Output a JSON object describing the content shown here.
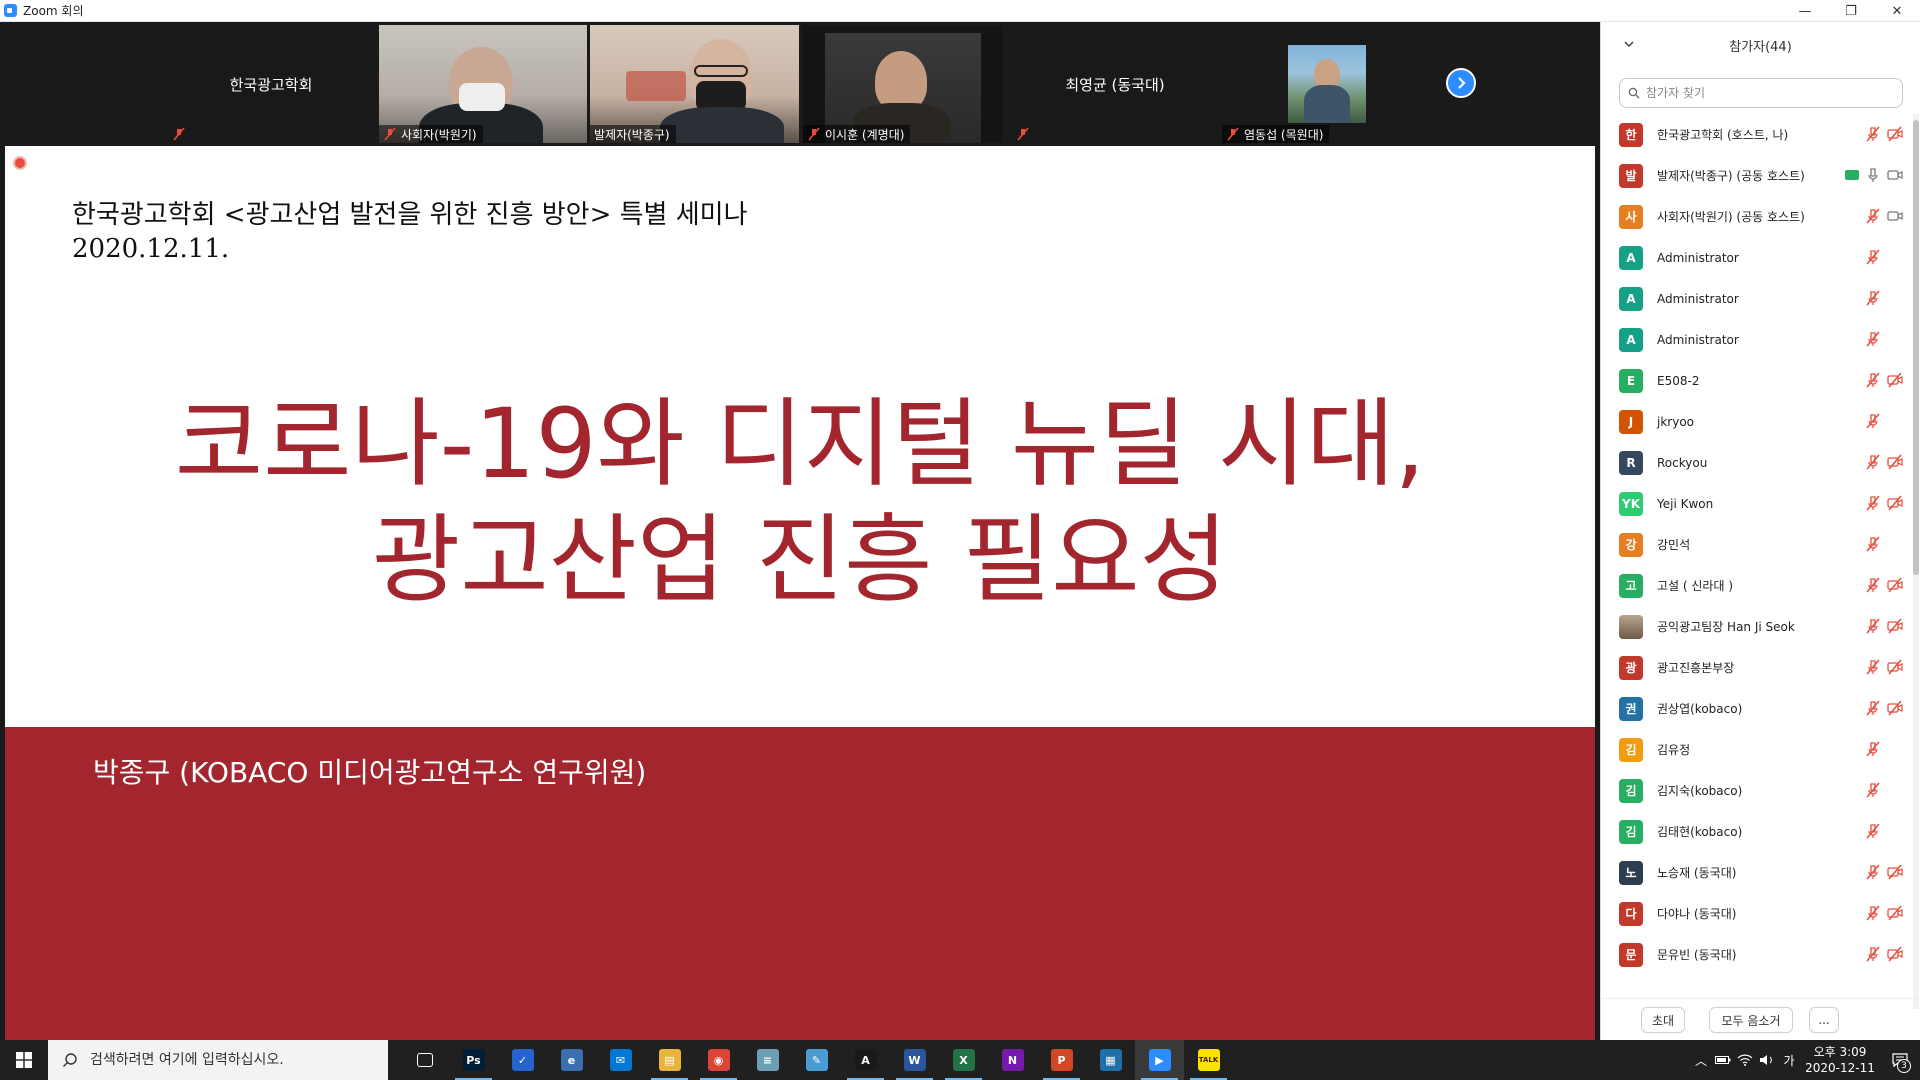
{
  "window": {
    "title": "Zoom 회의",
    "controls": [
      "—",
      "❐",
      "✕"
    ]
  },
  "thumbnails": [
    {
      "type": "name",
      "name": "한국광고학회",
      "label": "",
      "muted": true
    },
    {
      "type": "video",
      "name": "사회자(박원기)",
      "label": "사회자(박원기)",
      "muted": true
    },
    {
      "type": "video",
      "name": "발제자(박종구)",
      "label": "발제자(박종구)",
      "muted": false,
      "active": true
    },
    {
      "type": "video",
      "name": "이시훈 (계명대)",
      "label": "이시훈 (계명대)",
      "muted": true
    },
    {
      "type": "name",
      "name": "최영균 (동국대)",
      "label": "",
      "muted": true
    },
    {
      "type": "video",
      "name": "염동섭 (목원대)",
      "label": "염동섭 (목원대)",
      "muted": true
    }
  ],
  "slide": {
    "header_line1": "한국광고학회 <광고산업 발전을 위한 진흥 방안> 특별 세미나",
    "header_line2": "2020.12.11.",
    "title_line1": "코로나-19와 디지털 뉴딜 시대,",
    "title_line2": "광고산업 진흥 필요성",
    "presenter": "박종구 (KOBACO 미디어광고연구소 연구위원)",
    "accent_color": "#a3262f"
  },
  "panel": {
    "title": "참가자(44)",
    "search_placeholder": "참가자 찾기",
    "participants": [
      {
        "initial": "한",
        "color": "#c0392b",
        "name": "한국광고학회 (호스트, 나)",
        "mic": "muted",
        "video": "off"
      },
      {
        "initial": "발",
        "color": "#c0392b",
        "name": "발제자(박종구) (공동 호스트)",
        "mic": "on",
        "video": "on",
        "sharing": true
      },
      {
        "initial": "사",
        "color": "#e67e22",
        "name": "사회자(박원기) (공동 호스트)",
        "mic": "muted",
        "video": "on"
      },
      {
        "initial": "A",
        "color": "#16a085",
        "name": "Administrator",
        "mic": "muted",
        "video": "none"
      },
      {
        "initial": "A",
        "color": "#16a085",
        "name": "Administrator",
        "mic": "muted",
        "video": "none"
      },
      {
        "initial": "A",
        "color": "#16a085",
        "name": "Administrator",
        "mic": "muted",
        "video": "none"
      },
      {
        "initial": "E",
        "color": "#27ae60",
        "name": "E508-2",
        "mic": "muted",
        "video": "off"
      },
      {
        "initial": "J",
        "color": "#d35400",
        "name": "jkryoo",
        "mic": "muted",
        "video": "none"
      },
      {
        "initial": "R",
        "color": "#34495e",
        "name": "Rockyou",
        "mic": "muted",
        "video": "off"
      },
      {
        "initial": "YK",
        "color": "#2ecc71",
        "name": "Yeji Kwon",
        "mic": "muted",
        "video": "off"
      },
      {
        "initial": "강",
        "color": "#e67e22",
        "name": "강민석",
        "mic": "muted",
        "video": "none"
      },
      {
        "initial": "고",
        "color": "#27ae60",
        "name": "고설 ( 신라대 )",
        "mic": "muted",
        "video": "off"
      },
      {
        "initial": "",
        "color": "#8d7b68",
        "name": "공익광고팀장 Han Ji Seok",
        "mic": "muted",
        "video": "off",
        "photo": true
      },
      {
        "initial": "광",
        "color": "#c0392b",
        "name": "광고진흥본부장",
        "mic": "muted",
        "video": "off"
      },
      {
        "initial": "권",
        "color": "#2471a3",
        "name": "권상엽(kobaco)",
        "mic": "muted",
        "video": "off"
      },
      {
        "initial": "김",
        "color": "#f39c12",
        "name": "김유정",
        "mic": "muted",
        "video": "none"
      },
      {
        "initial": "김",
        "color": "#27ae60",
        "name": "김지숙(kobaco)",
        "mic": "muted",
        "video": "none"
      },
      {
        "initial": "김",
        "color": "#27ae60",
        "name": "김태현(kobaco)",
        "mic": "muted",
        "video": "none"
      },
      {
        "initial": "노",
        "color": "#2c3e50",
        "name": "노승재 (동국대)",
        "mic": "muted",
        "video": "off"
      },
      {
        "initial": "다",
        "color": "#c0392b",
        "name": "다야나 (동국대)",
        "mic": "muted",
        "video": "off"
      },
      {
        "initial": "문",
        "color": "#c0392b",
        "name": "문유빈 (동국대)",
        "mic": "muted",
        "video": "off"
      }
    ],
    "invite_label": "초대",
    "mute_all_label": "모두 음소거",
    "more_label": "..."
  },
  "taskbar": {
    "search_placeholder": "검색하려면 여기에 입력하십시오.",
    "apps": [
      {
        "name": "task-view",
        "label": "",
        "color": "#202020"
      },
      {
        "name": "photoshop",
        "label": "Ps",
        "color": "#001e36"
      },
      {
        "name": "todo",
        "label": "✓",
        "color": "#2564cf"
      },
      {
        "name": "edge-legacy",
        "label": "e",
        "color": "#3a6fb0"
      },
      {
        "name": "mail",
        "label": "✉",
        "color": "#0078d4"
      },
      {
        "name": "file-explorer",
        "label": "▤",
        "color": "#e8b43a"
      },
      {
        "name": "chrome",
        "label": "◉",
        "color": "#db4437"
      },
      {
        "name": "notepad",
        "label": "≡",
        "color": "#6a9fb5"
      },
      {
        "name": "paint",
        "label": "✎",
        "color": "#4b9cd3"
      },
      {
        "name": "acrobat",
        "label": "A",
        "color": "#1a1a1a"
      },
      {
        "name": "word",
        "label": "W",
        "color": "#2b579a"
      },
      {
        "name": "excel",
        "label": "X",
        "color": "#217346"
      },
      {
        "name": "onenote",
        "label": "N",
        "color": "#7719aa"
      },
      {
        "name": "powerpoint",
        "label": "P",
        "color": "#d24726"
      },
      {
        "name": "calculator",
        "label": "▦",
        "color": "#1f6fa8"
      },
      {
        "name": "zoom",
        "label": "▶",
        "color": "#2d8cff"
      },
      {
        "name": "kakaotalk",
        "label": "TALK",
        "color": "#fae100"
      }
    ],
    "tray": {
      "chevron": "︿",
      "ime": "가",
      "time": "오후 3:09",
      "date": "2020-12-11",
      "notifications": "3"
    }
  }
}
